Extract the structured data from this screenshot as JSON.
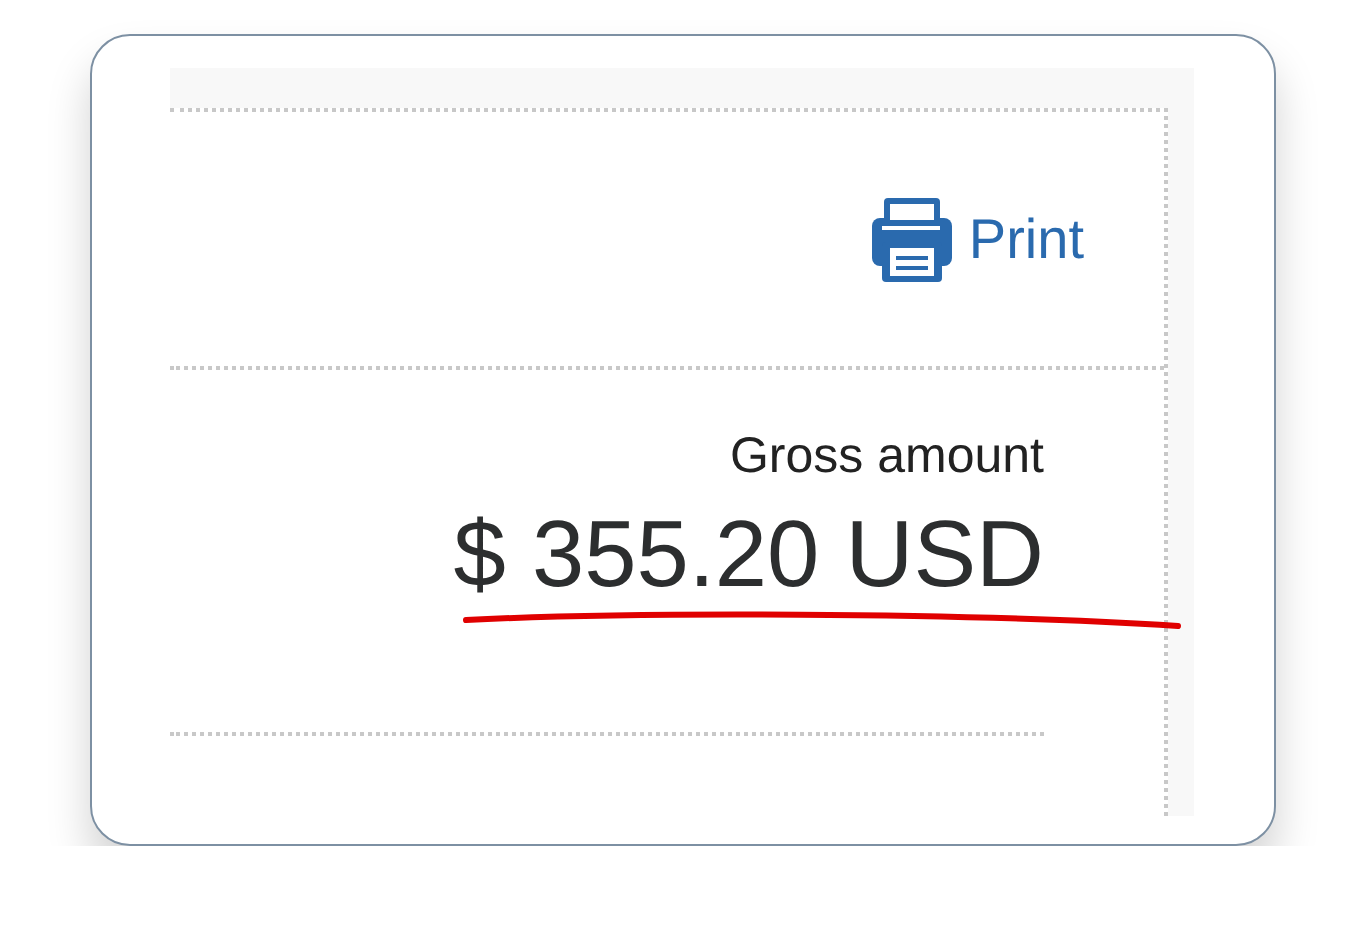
{
  "print_link": {
    "label": "Print"
  },
  "summary": {
    "label": "Gross amount",
    "amount": "$ 355.20 USD"
  }
}
